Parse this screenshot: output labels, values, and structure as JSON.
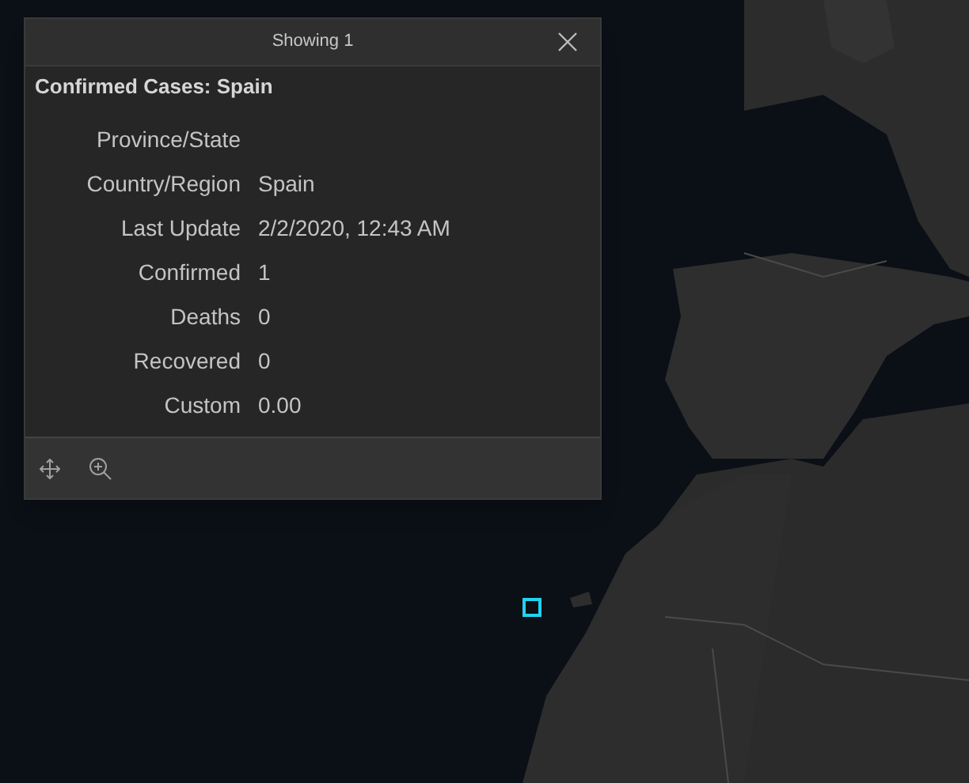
{
  "popup": {
    "header": "Showing 1",
    "title": "Confirmed Cases: Spain",
    "fields": [
      {
        "label": "Province/State"
      },
      {
        "label": "Country/Region",
        "value": "Spain"
      },
      {
        "label": "Last Update",
        "value": "2/2/2020, 12:43 AM"
      },
      {
        "label": "Confirmed",
        "value": "1"
      },
      {
        "label": "Deaths",
        "value": "0"
      },
      {
        "label": "Recovered",
        "value": "0"
      },
      {
        "label": "Custom",
        "value": "0.00"
      }
    ]
  }
}
